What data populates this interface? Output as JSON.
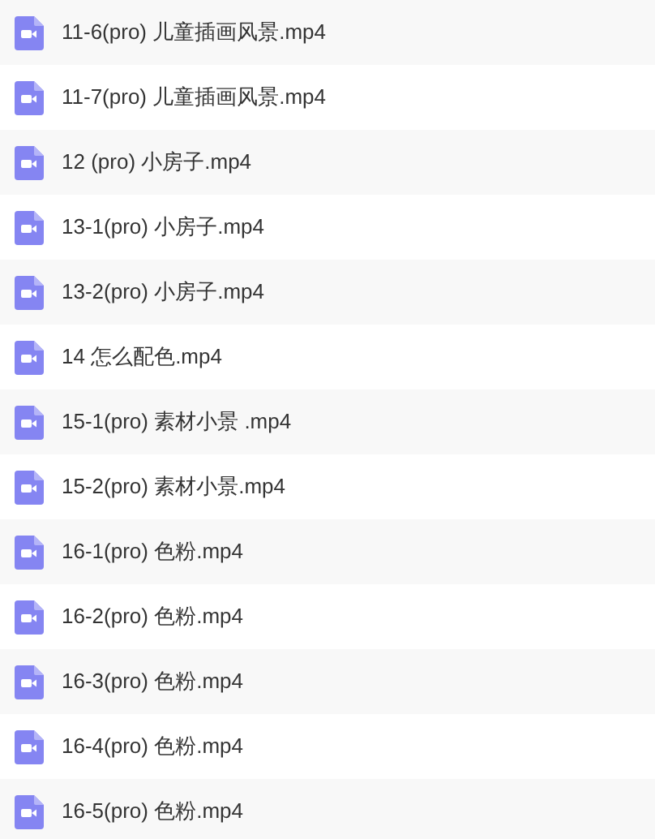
{
  "files": [
    {
      "name": "11-6(pro) 儿童插画风景.mp4"
    },
    {
      "name": "11-7(pro) 儿童插画风景.mp4"
    },
    {
      "name": "12 (pro) 小房子.mp4"
    },
    {
      "name": "13-1(pro) 小房子.mp4"
    },
    {
      "name": "13-2(pro) 小房子.mp4"
    },
    {
      "name": "14 怎么配色.mp4"
    },
    {
      "name": "15-1(pro) 素材小景 .mp4"
    },
    {
      "name": "15-2(pro) 素材小景.mp4"
    },
    {
      "name": "16-1(pro) 色粉.mp4"
    },
    {
      "name": "16-2(pro) 色粉.mp4"
    },
    {
      "name": "16-3(pro) 色粉.mp4"
    },
    {
      "name": "16-4(pro) 色粉.mp4"
    },
    {
      "name": "16-5(pro) 色粉.mp4"
    }
  ]
}
